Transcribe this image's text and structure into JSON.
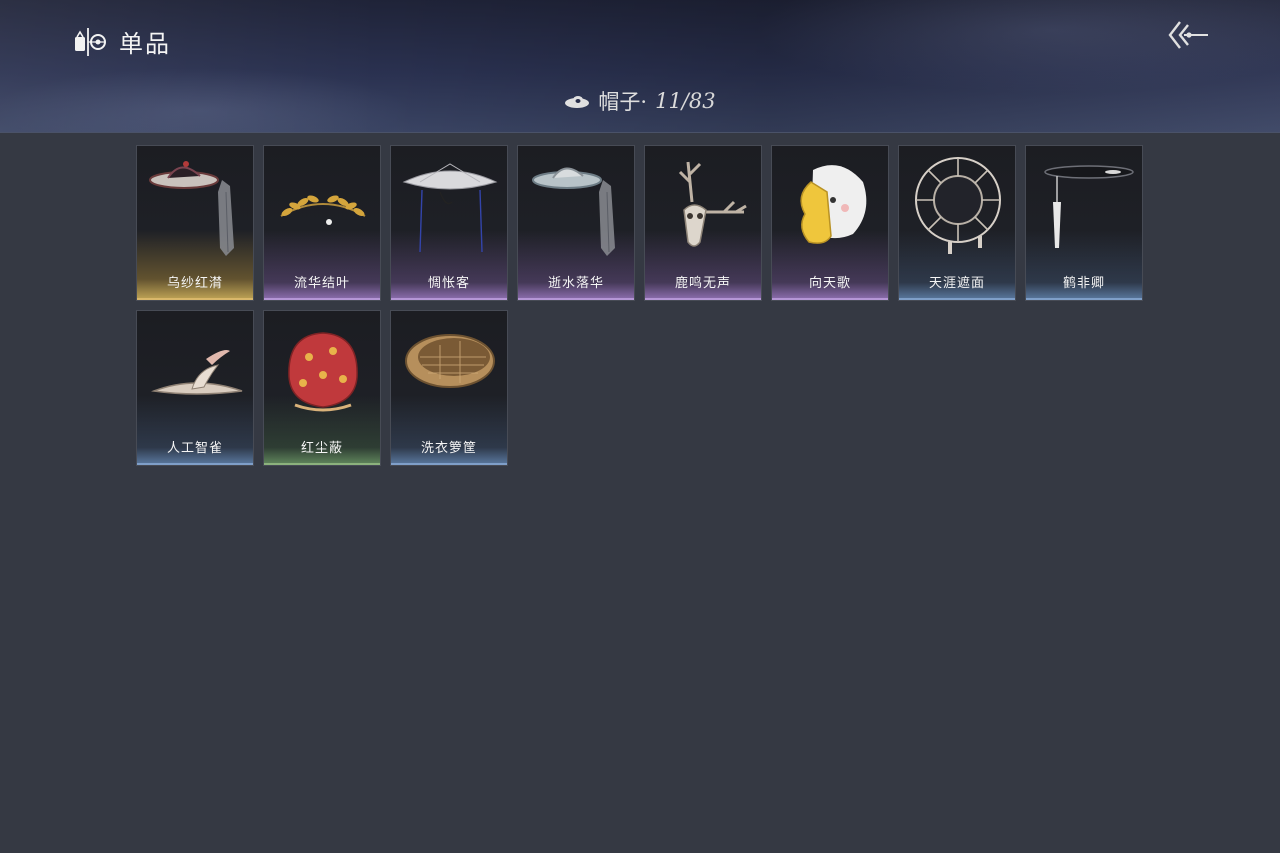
{
  "header": {
    "section_icon": "wardrobe-item-icon",
    "section_title": "单品",
    "back_icon": "back-arrow-icon"
  },
  "category": {
    "icon": "hat-icon",
    "label": "帽子·",
    "count": "11/83"
  },
  "items": [
    {
      "name": "乌纱红潸",
      "rarity": "gold",
      "icon": "veiled-hat-icon"
    },
    {
      "name": "流华结叶",
      "rarity": "purple",
      "icon": "laurel-wreath-icon"
    },
    {
      "name": "惆怅客",
      "rarity": "purple",
      "icon": "conical-hat-icon"
    },
    {
      "name": "逝水落华",
      "rarity": "purple",
      "icon": "veiled-hat-icon"
    },
    {
      "name": "鹿鸣无声",
      "rarity": "purple",
      "icon": "deer-skull-icon"
    },
    {
      "name": "向天歌",
      "rarity": "purple",
      "icon": "duck-hood-icon"
    },
    {
      "name": "天涯遮面",
      "rarity": "blue",
      "icon": "rattan-hat-icon"
    },
    {
      "name": "鹤非卿",
      "rarity": "blue",
      "icon": "flat-black-hat-icon"
    },
    {
      "name": "人工智雀",
      "rarity": "blue",
      "icon": "bird-hat-icon"
    },
    {
      "name": "红尘蔽",
      "rarity": "green",
      "icon": "red-hood-icon"
    },
    {
      "name": "洗衣箩筐",
      "rarity": "blue",
      "icon": "basket-hat-icon"
    }
  ],
  "colors": {
    "background": "#353943",
    "gold": "#d9b86a",
    "purple": "#b596d6",
    "blue": "#7f9fc9",
    "green": "#8cb27d"
  }
}
